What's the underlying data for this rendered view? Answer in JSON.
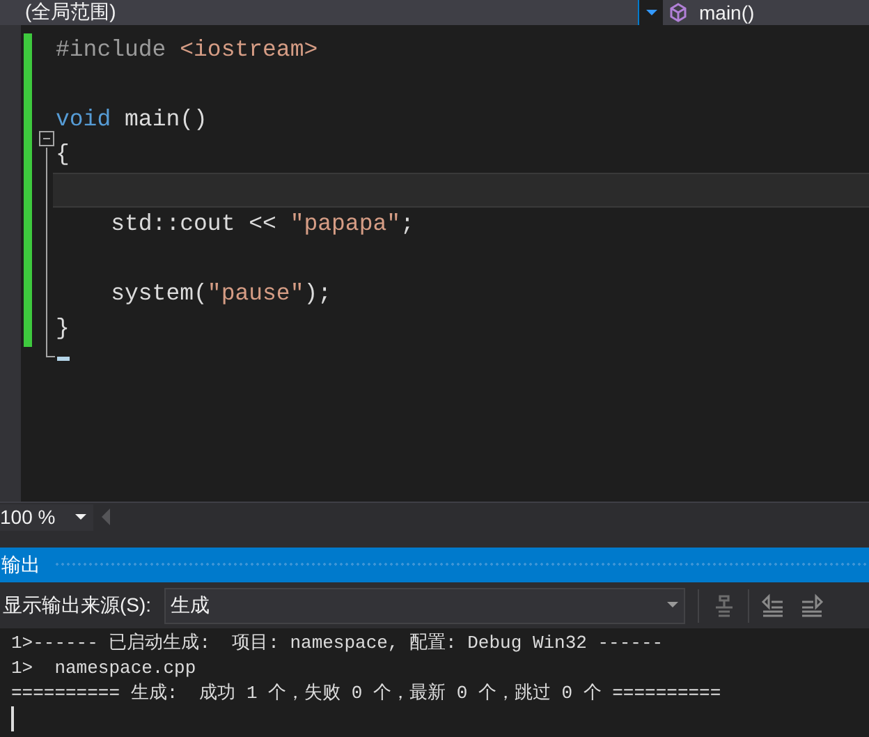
{
  "navigation_bar": {
    "scope": "(全局范围)",
    "member": "main()"
  },
  "editor": {
    "lines": [
      {
        "current": false,
        "tokens": [
          {
            "kind": "preproc",
            "text": "#include "
          },
          {
            "kind": "string",
            "text": "<iostream>"
          }
        ]
      },
      {
        "current": false
      },
      {
        "current": false,
        "tokens": [
          {
            "kind": "keyword",
            "text": "void"
          },
          {
            "kind": "plain",
            "text": " main()"
          }
        ]
      },
      {
        "current": false,
        "tokens": [
          {
            "kind": "plain",
            "text": "{"
          }
        ]
      },
      {
        "current": true
      },
      {
        "current": false,
        "tokens": [
          {
            "kind": "plain",
            "text": "    std::cout << "
          },
          {
            "kind": "string",
            "text": "\"papapa\""
          },
          {
            "kind": "plain",
            "text": ";"
          }
        ]
      },
      {
        "current": false
      },
      {
        "current": false,
        "tokens": [
          {
            "kind": "plain",
            "text": "    system("
          },
          {
            "kind": "string",
            "text": "\"pause\""
          },
          {
            "kind": "plain",
            "text": ");"
          }
        ]
      },
      {
        "current": false,
        "tokens": [
          {
            "kind": "plain",
            "text": "}"
          }
        ]
      }
    ],
    "zoom": "100 %"
  },
  "output_panel": {
    "title": "输出",
    "source_label": "显示输出来源(S):",
    "source": "生成",
    "lines": [
      "1>------ 已启动生成:  项目: namespace, 配置: Debug Win32 ------",
      "1>  namespace.cpp",
      "========== 生成:  成功 1 个，失败 0 个，最新 0 个，跳过 0 个 =========="
    ]
  }
}
